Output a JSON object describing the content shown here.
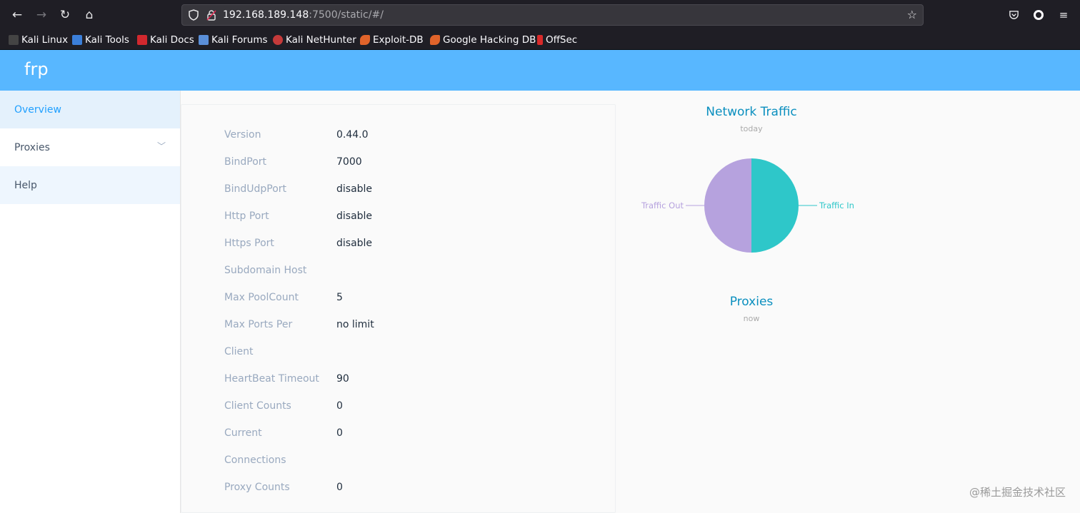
{
  "browser": {
    "url_host": "192.168.189.148",
    "url_rest": ":7500/static/#/",
    "bookmarks": [
      "Kali Linux",
      "Kali Tools",
      "Kali Docs",
      "Kali Forums",
      "Kali NetHunter",
      "Exploit-DB",
      "Google Hacking DB",
      "OffSec"
    ]
  },
  "app": {
    "brand": "frp"
  },
  "sidebar": {
    "items": [
      {
        "label": "Overview"
      },
      {
        "label": "Proxies"
      },
      {
        "label": "Help"
      }
    ]
  },
  "overview": {
    "rows": [
      {
        "key": "Version",
        "value": "0.44.0"
      },
      {
        "key": "BindPort",
        "value": "7000"
      },
      {
        "key": "BindUdpPort",
        "value": "disable"
      },
      {
        "key": "Http Port",
        "value": "disable"
      },
      {
        "key": "Https Port",
        "value": "disable"
      },
      {
        "key": "Subdomain Host",
        "value": ""
      },
      {
        "key": "Max PoolCount",
        "value": "5"
      },
      {
        "key": "Max Ports Per",
        "value": "no limit"
      },
      {
        "key": "Client",
        "value": ""
      },
      {
        "key": "HeartBeat Timeout",
        "value": "90"
      },
      {
        "key": "Client Counts",
        "value": "0"
      },
      {
        "key": "Current",
        "value": "0"
      },
      {
        "key": "Connections",
        "value": ""
      },
      {
        "key": "Proxy Counts",
        "value": "0"
      }
    ]
  },
  "traffic_chart": {
    "title": "Network Traffic",
    "subtitle": "today"
  },
  "proxies_chart": {
    "title": "Proxies",
    "subtitle": "now"
  },
  "watermark": "@稀土掘金技术社区",
  "chart_data": {
    "type": "pie",
    "title": "Network Traffic",
    "subtitle": "today",
    "categories": [
      "Traffic In",
      "Traffic Out"
    ],
    "values": [
      50,
      50
    ],
    "colors": [
      "#2ec7c9",
      "#b6a2de"
    ]
  }
}
